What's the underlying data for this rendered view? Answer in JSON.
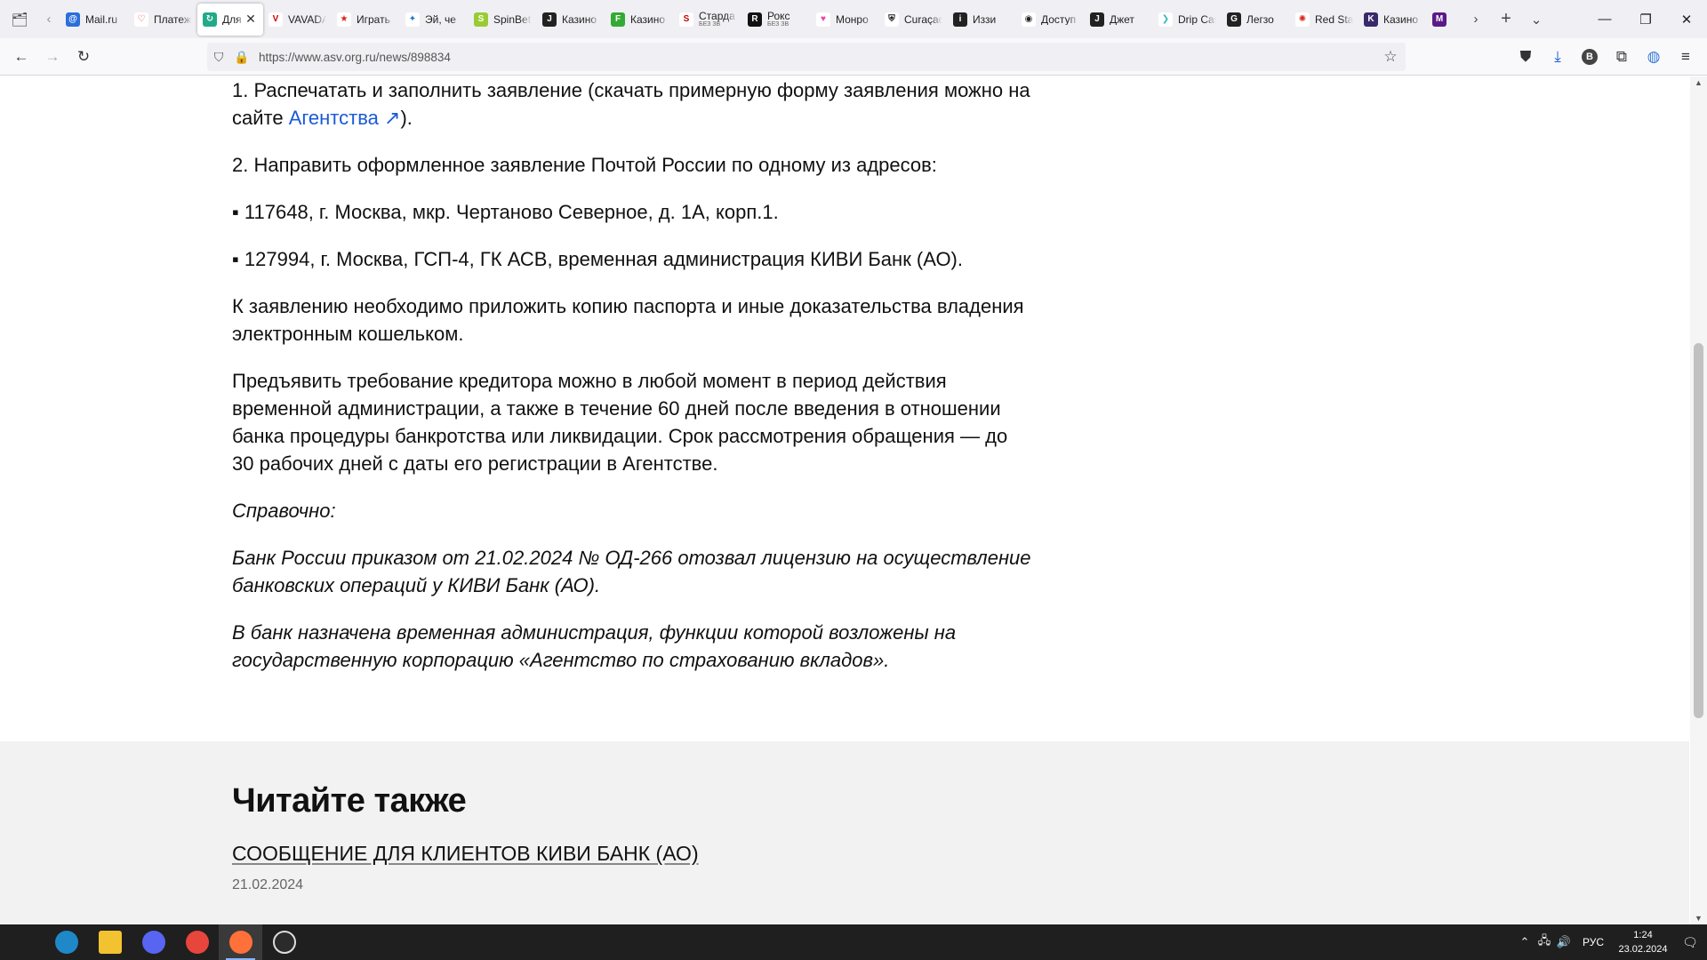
{
  "browser": {
    "tabs": [
      {
        "label": "Mail.ru",
        "color": "#2a6fdb",
        "glyph": "@"
      },
      {
        "label": "Платежи",
        "color": "#ffffff",
        "glyph": "♡",
        "glyph_color": "#d33"
      },
      {
        "label": "Для клиентов",
        "color": "#2a8",
        "glyph": "↻",
        "active": true
      },
      {
        "label": "VAVADA",
        "color": "#ffffff",
        "glyph": "V",
        "glyph_color": "#c00"
      },
      {
        "label": "Играть",
        "color": "#ffffff",
        "glyph": "★",
        "glyph_color": "#d22"
      },
      {
        "label": "Эй, че",
        "color": "#ffffff",
        "glyph": "✦",
        "glyph_color": "#27c"
      },
      {
        "label": "SpinBetter",
        "color": "#9c3",
        "glyph": "S"
      },
      {
        "label": "Казино",
        "color": "#222",
        "glyph": "J"
      },
      {
        "label": "Казино",
        "color": "#3a3",
        "glyph": "F"
      },
      {
        "label": "Старда",
        "sub": "БЕЗ ЗВ",
        "color": "#ffffff",
        "glyph": "S",
        "glyph_color": "#c00"
      },
      {
        "label": "Рокс",
        "sub": "БЕЗ ЗВ",
        "color": "#111",
        "glyph": "R"
      },
      {
        "label": "Монро",
        "color": "#ffffff",
        "glyph": "♥",
        "glyph_color": "#e4a"
      },
      {
        "label": "Curaçao",
        "color": "#ffffff",
        "glyph": "⛨",
        "glyph_color": "#111"
      },
      {
        "label": "Иззи",
        "color": "#222",
        "glyph": "i"
      },
      {
        "label": "Доступ",
        "color": "#ffffff",
        "glyph": "◉",
        "glyph_color": "#222"
      },
      {
        "label": "Джет",
        "color": "#222",
        "glyph": "J"
      },
      {
        "label": "Drip Casino",
        "color": "#ffffff",
        "glyph": "❯",
        "glyph_color": "#3bb"
      },
      {
        "label": "Легзо",
        "color": "#222",
        "glyph": "G"
      },
      {
        "label": "Red Star",
        "color": "#ffffff",
        "glyph": "✺",
        "glyph_color": "#d22"
      },
      {
        "label": "Казино",
        "color": "#3a2a6a",
        "glyph": "K"
      },
      {
        "label": "",
        "color": "#5a1a8a",
        "glyph": "M"
      }
    ],
    "url": "https://www.asv.org.ru/news/898834",
    "profile_initial": "B"
  },
  "article": {
    "p1_text": "1. Распечатать и заполнить заявление (скачать примерную форму заявления можно на сайте ",
    "p1_link": "Агентства ↗",
    "p1_end": ").",
    "p2": "2. Направить оформленное заявление Почтой России по одному из адресов:",
    "p3": "▪ 117648, г. Москва, мкр. Чертаново Северное, д. 1А, корп.1.",
    "p4": "▪ 127994, г. Москва, ГСП-4, ГК АСВ, временная администрация КИВИ Банк (АО).",
    "p5": "К заявлению необходимо приложить копию паспорта и иные доказательства владения электронным кошельком.",
    "p6": "Предъявить требование кредитора можно в любой момент в период действия временной администрации, а также в течение 60 дней после введения в отношении банка процедуры банкротства или ликвидации. Срок рассмотрения обращения — до 30 рабочих дней с даты его регистрации в Агентстве.",
    "p7": "Справочно:",
    "p8": "Банк России приказом от 21.02.2024 № ОД-266 отозвал лицензию на осуществление банковских операций у КИВИ Банк (АО).",
    "p9": "В банк назначена временная администрация, функции которой возложены на государственную корпорацию «Агентство по страхованию вкладов»."
  },
  "related": {
    "title": "Читайте также",
    "link": "СООБЩЕНИЕ ДЛЯ КЛИЕНТОВ КИВИ БАНК (АО)",
    "date": "21.02.2024"
  },
  "taskbar": {
    "apps": [
      {
        "name": "edge",
        "color": "#1e88c8",
        "active": false
      },
      {
        "name": "explorer",
        "color": "#f2c230",
        "active": false
      },
      {
        "name": "discord",
        "color": "#5865f2",
        "active": false
      },
      {
        "name": "chrome",
        "color": "#e8453c",
        "active": false
      },
      {
        "name": "firefox",
        "color": "#ff7139",
        "active": true
      },
      {
        "name": "obs",
        "color": "#2b2b2b",
        "active": false
      }
    ],
    "lang": "РУС",
    "time": "1:24",
    "date": "23.02.2024"
  }
}
